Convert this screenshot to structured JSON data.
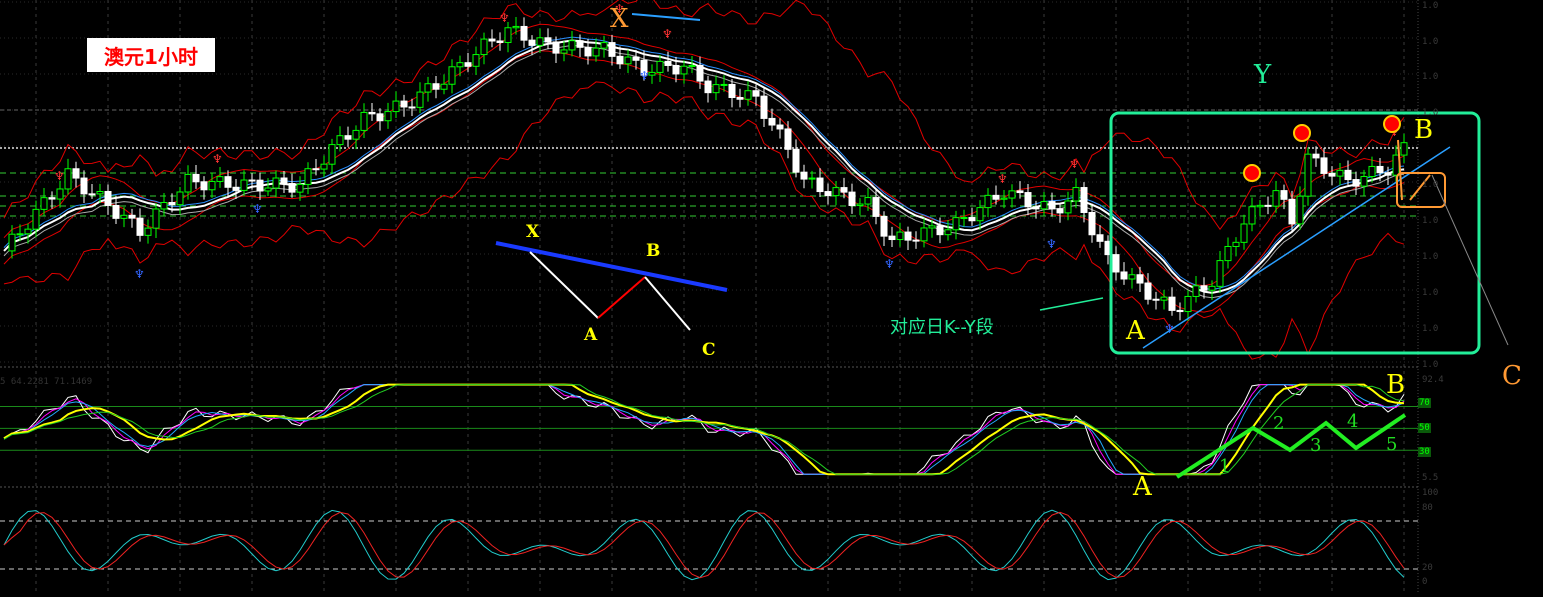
{
  "title": "澳元1小时",
  "indicator_readout": "5 64.2281 71.1469",
  "annotations": {
    "main_x": "X",
    "main_y": "Y",
    "main_b": "B",
    "main_a": "A",
    "main_c": "C",
    "daily_note": "对应日K--Y段",
    "diagram_x": "X",
    "diagram_a": "A",
    "diagram_b": "B",
    "diagram_c": "C",
    "osc_a": "A",
    "osc_b": "B",
    "wave_1": "1",
    "wave_2": "2",
    "wave_3": "3",
    "wave_4": "4",
    "wave_5": "5"
  },
  "price_axis_labels": [
    "1.0",
    "1.0",
    "1.0",
    "1.0",
    "1.0",
    "1.0",
    "1.0",
    "1.0",
    "1.0",
    "1.0"
  ],
  "osc_axis": {
    "top": "92.4",
    "l70": "70",
    "l50": "50",
    "l30": "30",
    "bottom": "5.5"
  },
  "stoch_axis": {
    "top": "100",
    "l80": "80",
    "l20": "20",
    "bottom": "0"
  },
  "colors": {
    "bull": "#00ff00",
    "bear": "#ffffff",
    "band": "#e00000",
    "ma": "#ffffff",
    "ma2": "#2a8fff",
    "box": "#22ee99",
    "annotation": "#ffff00",
    "orange": "#ff9933"
  },
  "chart_data": {
    "type": "candlestick",
    "title": "澳元1小时",
    "xlabel": "",
    "ylabel": "",
    "ylim": [
      0,
      100
    ],
    "price_waypoints": [
      [
        0,
        27
      ],
      [
        8,
        50
      ],
      [
        13,
        41
      ],
      [
        17,
        33
      ],
      [
        23,
        48
      ],
      [
        30,
        47
      ],
      [
        37,
        47
      ],
      [
        41,
        58
      ],
      [
        45,
        67
      ],
      [
        50,
        71
      ],
      [
        55,
        79
      ],
      [
        60,
        89
      ],
      [
        63,
        94
      ],
      [
        68,
        89
      ],
      [
        75,
        88
      ],
      [
        80,
        82
      ],
      [
        85,
        83
      ],
      [
        88,
        77
      ],
      [
        94,
        73
      ],
      [
        98,
        58
      ],
      [
        100,
        48
      ],
      [
        108,
        41
      ],
      [
        111,
        30
      ],
      [
        119,
        35
      ],
      [
        125,
        45
      ],
      [
        131,
        39
      ],
      [
        134,
        44
      ],
      [
        138,
        24
      ],
      [
        141,
        18
      ],
      [
        146,
        9
      ],
      [
        151,
        18
      ],
      [
        155,
        36
      ],
      [
        159,
        45
      ],
      [
        161,
        36
      ],
      [
        163,
        55
      ],
      [
        168,
        48
      ],
      [
        173,
        52
      ],
      [
        175,
        58
      ]
    ],
    "oscillator_levels": [
      70,
      50,
      30
    ],
    "stochastic_levels": [
      80,
      20
    ]
  }
}
